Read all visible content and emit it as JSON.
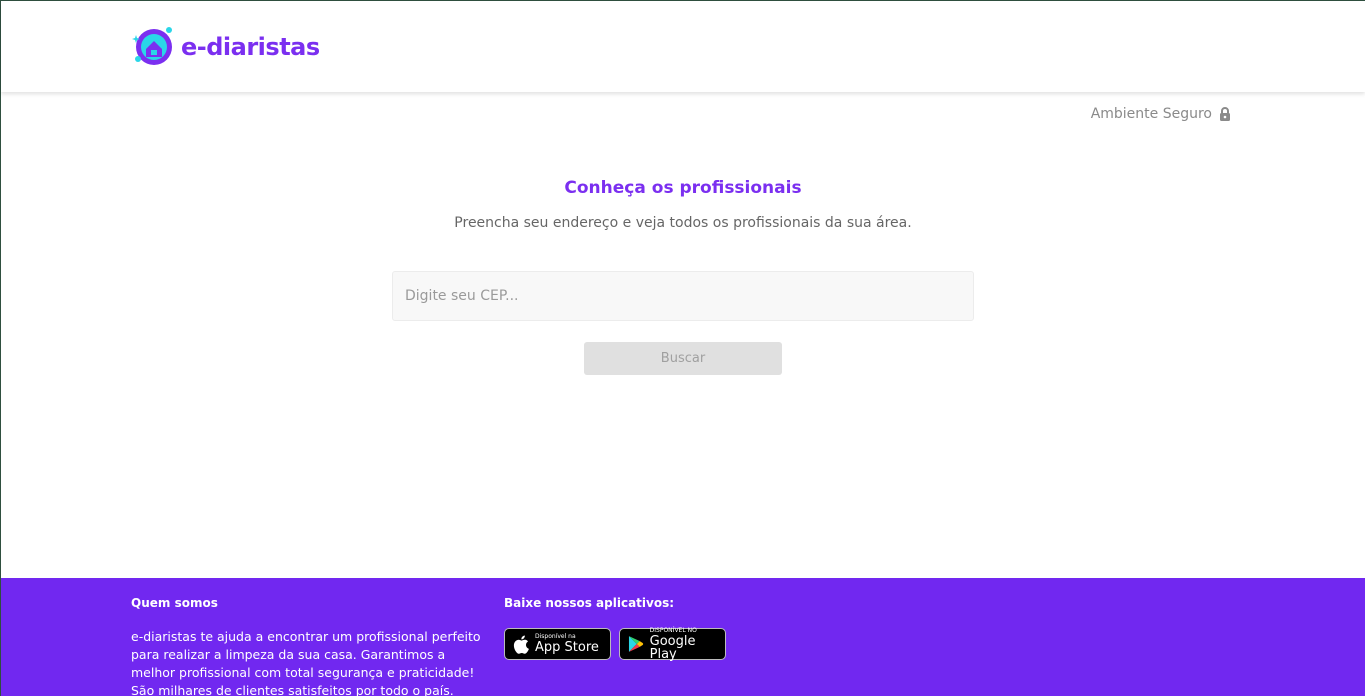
{
  "header": {
    "brand": "e-diaristas"
  },
  "secure": {
    "label": "Ambiente Seguro"
  },
  "main": {
    "title": "Conheça os profissionais",
    "subtitle": "Preencha seu endereço e veja todos os profissionais da sua área.",
    "cep_placeholder": "Digite seu CEP...",
    "search_button": "Buscar"
  },
  "footer": {
    "about_title": "Quem somos",
    "about_text": "e-diaristas te ajuda a encontrar um profissional perfeito para realizar a limpeza da sua casa. Garantimos a melhor profissional com total segurança e praticidade! São milhares de clientes satisfeitos por todo o país.",
    "apps_title": "Baixe nossos aplicativos:",
    "appstore_small": "Disponível na",
    "appstore_big": "App Store",
    "googleplay_small": "DISPONÍVEL NO",
    "googleplay_big": "Google Play"
  },
  "colors": {
    "brand": "#7b2ff0",
    "footer_bg": "#7128f0",
    "accent_cyan": "#2ad6e8"
  }
}
